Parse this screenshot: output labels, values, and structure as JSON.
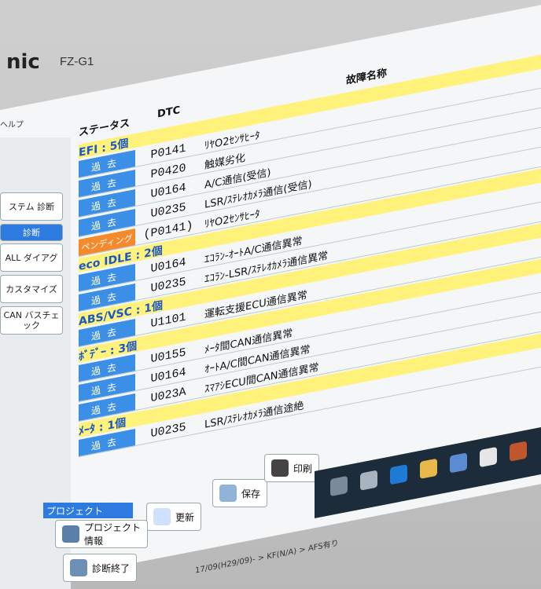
{
  "device": {
    "brand": "nic",
    "model": "FZ-G1"
  },
  "menu": {
    "help": "ヘルプ"
  },
  "sidebar": {
    "items": [
      {
        "label": "ステム\n診断"
      },
      {
        "label": "診断"
      },
      {
        "label": "ALL\nダイアグ"
      },
      {
        "label": "カスタマイズ"
      },
      {
        "label": "CAN\nバスチェック"
      }
    ]
  },
  "table": {
    "header_status": "ステータス",
    "header_dtc": "DTC",
    "header_name": "故障名称",
    "groups": [
      {
        "label": "EFI : 5個",
        "rows": [
          {
            "status": "過去",
            "dtc": "P0141",
            "name": "ﾘﾔO2ｾﾝｻﾋｰﾀ"
          },
          {
            "status": "過去",
            "dtc": "P0420",
            "name": "触媒劣化"
          },
          {
            "status": "過去",
            "dtc": "U0164",
            "name": "A/C通信(受信)"
          },
          {
            "status": "過去",
            "dtc": "U0235",
            "name": "LSR/ｽﾃﾚｵｶﾒﾗ通信(受信)"
          },
          {
            "status": "ペンディング",
            "dtc": "(P0141)",
            "name": "ﾘﾔO2ｾﾝｻﾋｰﾀ"
          }
        ]
      },
      {
        "label": "eco IDLE : 2個",
        "rows": [
          {
            "status": "過去",
            "dtc": "U0164",
            "name": "ｴｺﾗﾝ-ｵｰﾄA/C通信異常"
          },
          {
            "status": "過去",
            "dtc": "U0235",
            "name": "ｴｺﾗﾝ-LSR/ｽﾃﾚｵｶﾒﾗ通信異常"
          }
        ]
      },
      {
        "label": "ABS/VSC : 1個",
        "rows": [
          {
            "status": "過去",
            "dtc": "U1101",
            "name": "運転支援ECU通信異常"
          }
        ]
      },
      {
        "label": "ﾎﾞﾃﾞｰ : 3個",
        "rows": [
          {
            "status": "過去",
            "dtc": "U0155",
            "name": "ﾒｰﾀ間CAN通信異常"
          },
          {
            "status": "過去",
            "dtc": "U0164",
            "name": "ｵｰﾄA/C間CAN通信異常"
          },
          {
            "status": "過去",
            "dtc": "U023A",
            "name": "ｽﾏｱｼECU間CAN通信異常"
          }
        ]
      },
      {
        "label": "ﾒｰﾀ : 1個",
        "rows": [
          {
            "status": "過去",
            "dtc": "U0235",
            "name": "LSR/ｽﾃﾚｵｶﾒﾗ通信途絶"
          }
        ]
      }
    ]
  },
  "actions": {
    "refresh": "更新",
    "save": "保存",
    "print": "印刷"
  },
  "project": {
    "title": "プロジェクト",
    "info": "プロジェクト\n情報",
    "end": "診断終了"
  },
  "footer": "17/09(H29/09)- > KF(N/A) > AFS有り"
}
